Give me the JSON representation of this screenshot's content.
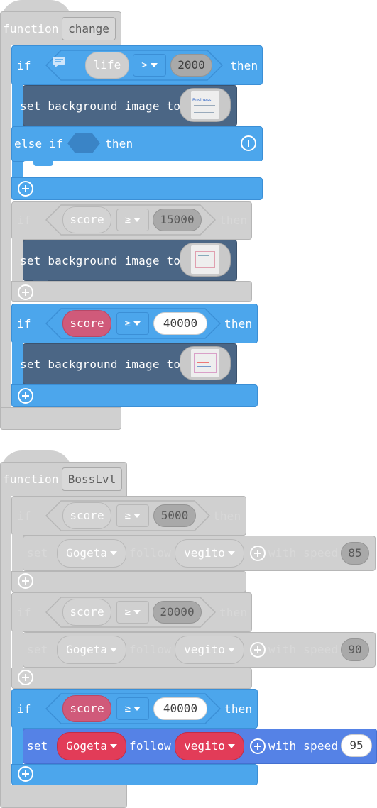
{
  "colors": {
    "blue": "#4ca6ec",
    "gray": "#d0d0d0",
    "navy": "#4b6685",
    "violet": "#5582e6",
    "red_var": "#e23c58",
    "pink_var": "#d05a7a"
  },
  "func1": {
    "keyword": "function",
    "name": "change",
    "if1": {
      "keyword": "if",
      "var": "life",
      "op": ">",
      "value": "2000",
      "then": "then",
      "stmt": "set background image to",
      "image_text": "Business",
      "elseif": "else if",
      "elseif_then": "then",
      "comment_icon": "comment-icon"
    },
    "if2": {
      "keyword": "if",
      "var": "score",
      "op": "≥",
      "value": "15000",
      "then": "then",
      "stmt": "set background image to"
    },
    "if3": {
      "keyword": "if",
      "var": "score",
      "op": "≥",
      "value": "40000",
      "then": "then",
      "stmt": "set background image to"
    }
  },
  "func2": {
    "keyword": "function",
    "name": "BossLvl",
    "if1": {
      "keyword": "if",
      "var": "score",
      "op": "≥",
      "value": "5000",
      "then": "then",
      "set": "set",
      "sprite": "Gogeta",
      "follow": "follow",
      "target": "vegito",
      "with_speed": "with speed",
      "speed": "85"
    },
    "if2": {
      "keyword": "if",
      "var": "score",
      "op": "≥",
      "value": "20000",
      "then": "then",
      "set": "set",
      "sprite": "Gogeta",
      "follow": "follow",
      "target": "vegito",
      "with_speed": "with speed",
      "speed": "90"
    },
    "if3": {
      "keyword": "if",
      "var": "score",
      "op": "≥",
      "value": "40000",
      "then": "then",
      "set": "set",
      "sprite": "Gogeta",
      "follow": "follow",
      "target": "vegito",
      "with_speed": "with speed",
      "speed": "95"
    }
  }
}
